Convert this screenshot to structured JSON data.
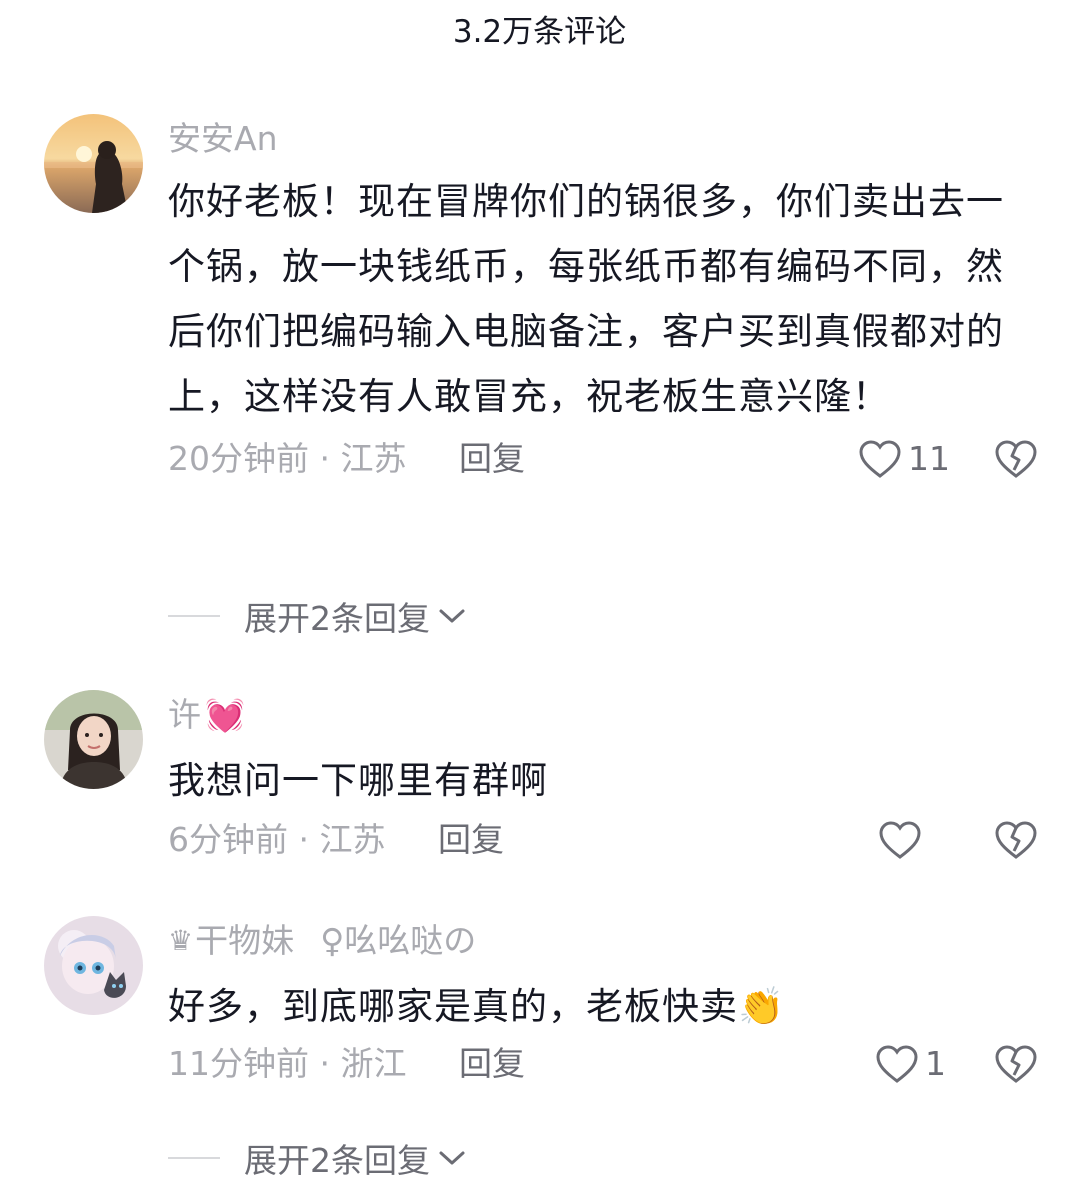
{
  "header": {
    "title": "3.2万条评论"
  },
  "comments": [
    {
      "author": "安安An",
      "text": "你好老板！现在冒牌你们的锅很多，你们卖出去一个锅，放一块钱纸币，每张纸币都有编码不同，然后你们把编码输入电脑备注，客户买到真假都对的上，这样没有人敢冒充，祝老板生意兴隆！",
      "time": "20分钟前",
      "location": "江苏",
      "reply_label": "回复",
      "like_count": "11",
      "expand_label": "展开2条回复"
    },
    {
      "author": "许",
      "author_emoji": "💓",
      "text": "我想问一下哪里有群啊",
      "time": "6分钟前",
      "location": "江苏",
      "reply_label": "回复",
      "like_count": ""
    },
    {
      "author_badge": "♛",
      "author": "干物妹",
      "author_extra": "♀吆吆哒の",
      "text": "好多，到底哪家是真的，老板快卖👏",
      "time": "11分钟前",
      "location": "浙江",
      "reply_label": "回复",
      "like_count": "1",
      "expand_label": "展开2条回复"
    }
  ],
  "separator": " · ",
  "colors": {
    "text": "#161823",
    "muted": "#a9aab0",
    "secondary": "#6b6c74"
  },
  "icons": [
    "heart-outline-icon",
    "broken-heart-icon",
    "chevron-down-icon"
  ]
}
